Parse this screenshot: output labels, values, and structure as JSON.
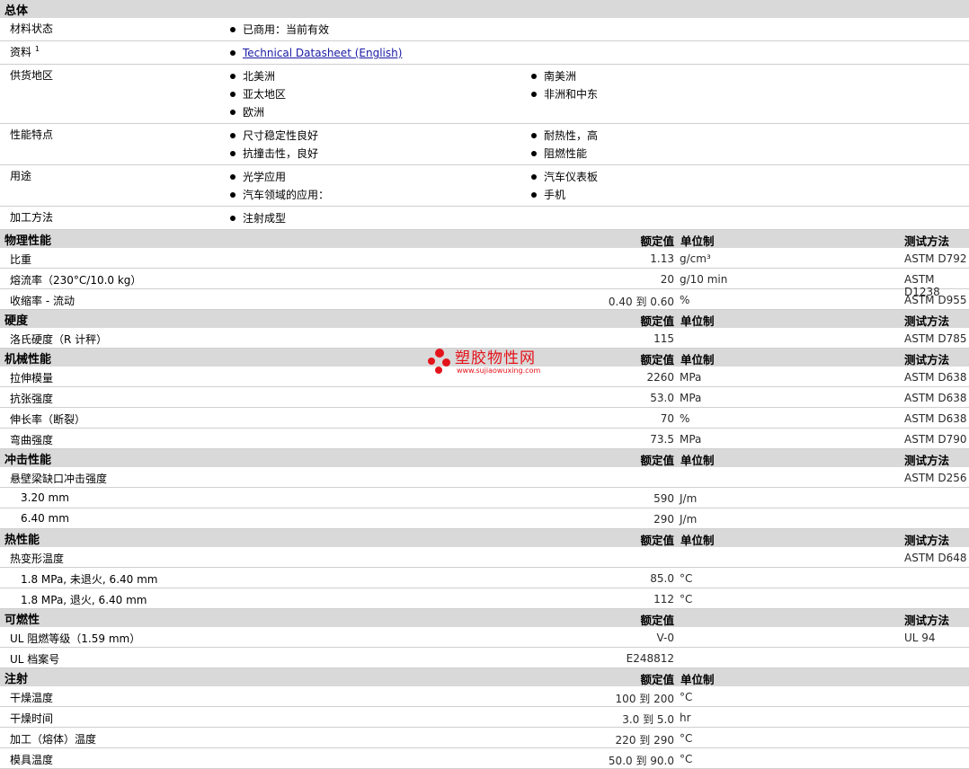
{
  "general": {
    "title": "总体",
    "rows": [
      {
        "label": "材料状态",
        "items": [
          "已商用：当前有效"
        ]
      },
      {
        "label": "资料",
        "sup": "1",
        "link": "Technical Datasheet (English)"
      },
      {
        "label": "供货地区",
        "items": [
          "北美洲",
          "南美洲",
          "亚太地区",
          "非洲和中东",
          "欧洲"
        ]
      },
      {
        "label": "性能特点",
        "items": [
          "尺寸稳定性良好",
          "耐热性，高",
          "抗撞击性，良好",
          "阻燃性能"
        ]
      },
      {
        "label": "用途",
        "items": [
          "光学应用",
          "汽车仪表板",
          "汽车领域的应用：",
          "手机"
        ]
      },
      {
        "label": "加工方法",
        "items": [
          "注射成型"
        ]
      }
    ]
  },
  "headers": {
    "nominal": "额定值",
    "unit": "单位制",
    "test": "测试方法"
  },
  "sections": [
    {
      "title": "物理性能",
      "showUnit": true,
      "showTest": true,
      "rows": [
        {
          "name": "比重",
          "value": "1.13",
          "unit": "g/cm³",
          "test": "ASTM D792"
        },
        {
          "name": "熔流率（230°C/10.0 kg）",
          "value": "20",
          "unit": "g/10 min",
          "test": "ASTM D1238"
        },
        {
          "name": "收缩率 - 流动",
          "value": "0.40 到  0.60",
          "unit": "%",
          "test": "ASTM D955"
        }
      ]
    },
    {
      "title": "硬度",
      "showUnit": true,
      "showTest": true,
      "rows": [
        {
          "name": "洛氏硬度（R 计秤）",
          "value": "115",
          "unit": "",
          "test": "ASTM D785"
        }
      ]
    },
    {
      "title": "机械性能",
      "showUnit": true,
      "showTest": true,
      "rows": [
        {
          "name": "拉伸模量",
          "value": "2260",
          "unit": "MPa",
          "test": "ASTM D638"
        },
        {
          "name": "抗张强度",
          "value": "53.0",
          "unit": "MPa",
          "test": "ASTM D638"
        },
        {
          "name": "伸长率（断裂）",
          "value": "70",
          "unit": "%",
          "test": "ASTM D638"
        },
        {
          "name": "弯曲强度",
          "value": "73.5",
          "unit": "MPa",
          "test": "ASTM D790"
        }
      ]
    },
    {
      "title": "冲击性能",
      "showUnit": true,
      "showTest": true,
      "rows": [
        {
          "name": "悬壁梁缺口冲击强度",
          "value": "",
          "unit": "",
          "test": "ASTM D256"
        },
        {
          "name": "3.20 mm",
          "sub": true,
          "value": "590",
          "unit": "J/m",
          "test": ""
        },
        {
          "name": "6.40 mm",
          "sub": true,
          "value": "290",
          "unit": "J/m",
          "test": ""
        }
      ]
    },
    {
      "title": "热性能",
      "showUnit": true,
      "showTest": true,
      "rows": [
        {
          "name": "热变形温度",
          "value": "",
          "unit": "",
          "test": "ASTM D648"
        },
        {
          "name": "1.8 MPa, 未退火, 6.40 mm",
          "sub": true,
          "value": "85.0",
          "unit": "°C",
          "test": ""
        },
        {
          "name": "1.8 MPa, 退火, 6.40 mm",
          "sub": true,
          "value": "112",
          "unit": "°C",
          "test": ""
        }
      ]
    },
    {
      "title": "可燃性",
      "showUnit": false,
      "showTest": true,
      "rows": [
        {
          "name": "UL 阻燃等级（1.59 mm）",
          "value": "V-0",
          "unit": "",
          "test": "UL 94"
        },
        {
          "name": "UL 档案号",
          "value": "E248812",
          "unit": "",
          "test": ""
        }
      ]
    },
    {
      "title": "注射",
      "showUnit": true,
      "showTest": false,
      "rows": [
        {
          "name": "干燥温度",
          "value": "100 到  200",
          "unit": "°C",
          "test": ""
        },
        {
          "name": "干燥时间",
          "value": "3.0 到  5.0",
          "unit": "hr",
          "test": ""
        },
        {
          "name": "加工（熔体）温度",
          "value": "220 到  290",
          "unit": "°C",
          "test": ""
        },
        {
          "name": "模具温度",
          "value": "50.0 到  90.0",
          "unit": "°C",
          "test": ""
        }
      ]
    }
  ],
  "watermark": {
    "cn": "塑胶物性网",
    "en": "www.sujiaowuxing.com",
    "color": "#e4131b"
  }
}
